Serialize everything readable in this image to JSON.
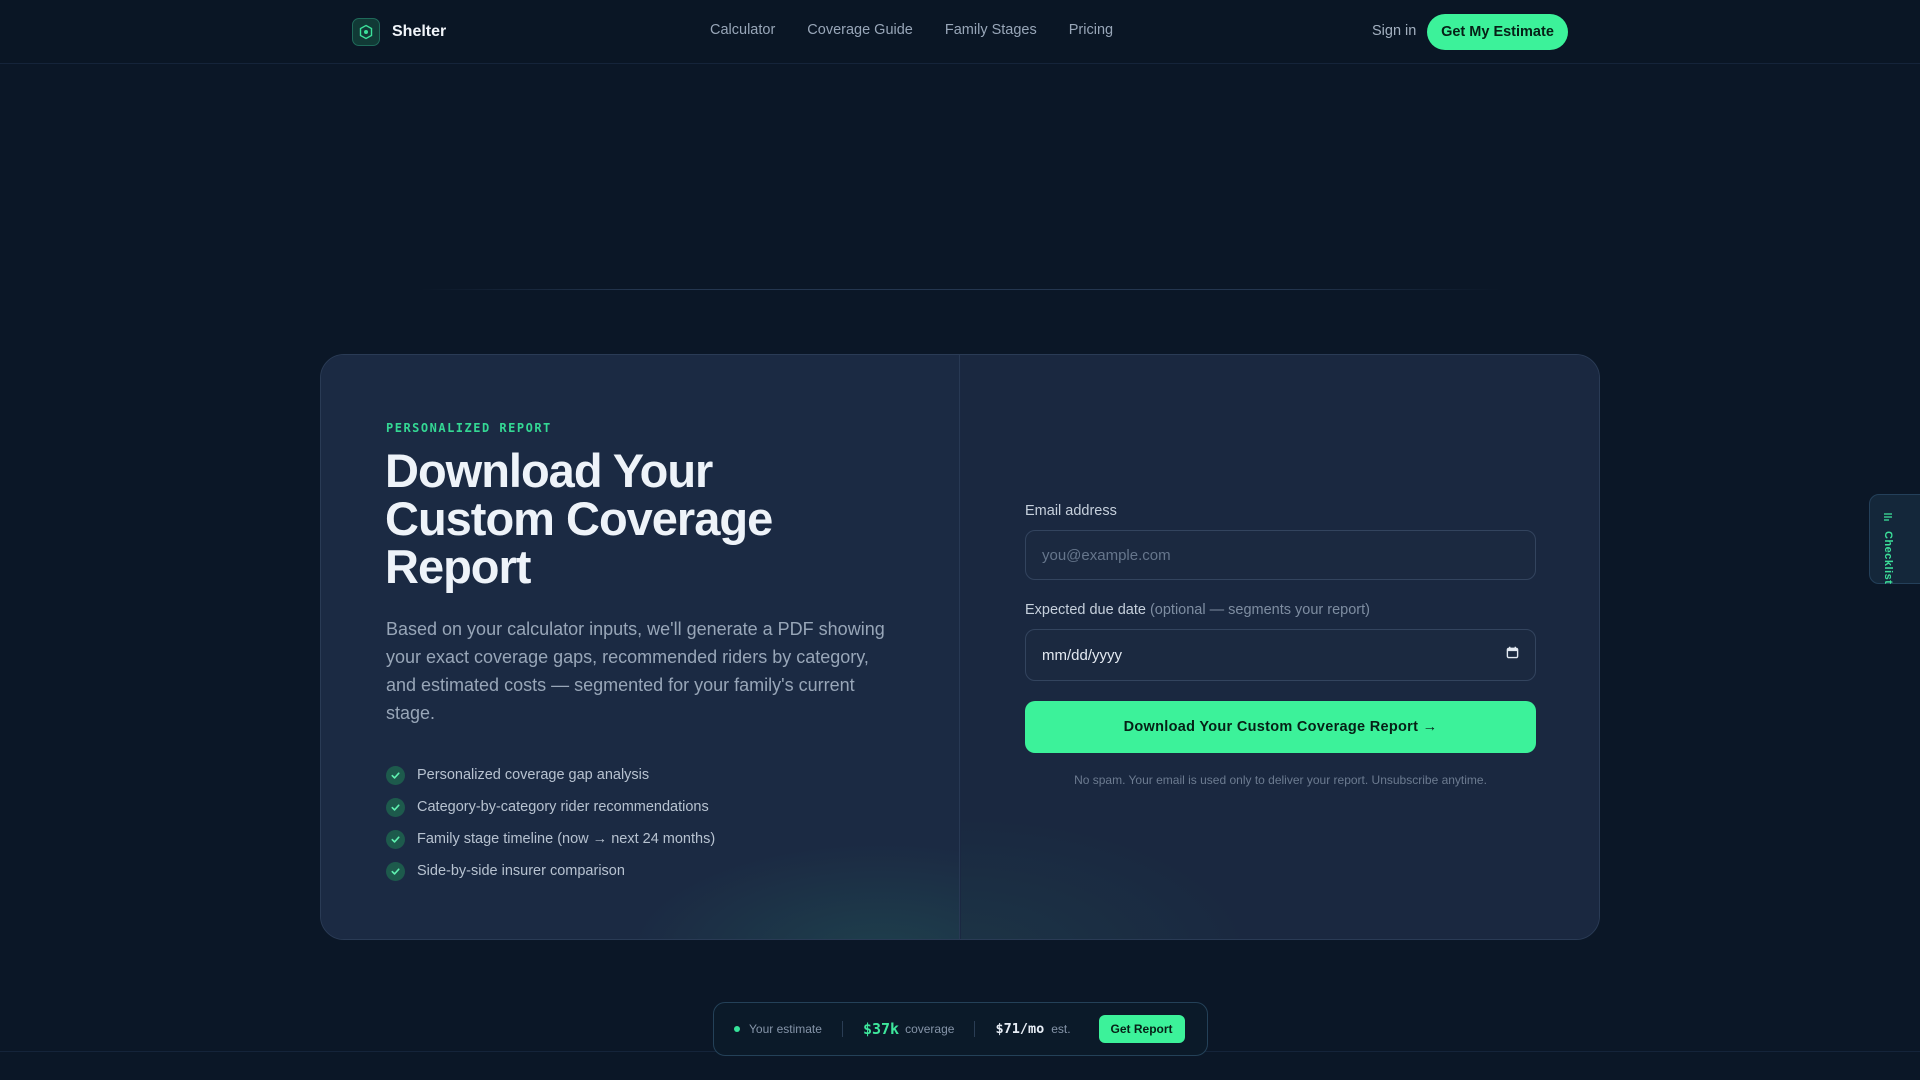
{
  "nav": {
    "brand": "Shelter",
    "links": [
      "Calculator",
      "Coverage Guide",
      "Family Stages",
      "Pricing"
    ],
    "signin": "Sign in",
    "cta": "Get My Estimate"
  },
  "report": {
    "eyebrow": "PERSONALIZED REPORT",
    "title": "Download Your Custom Coverage Report",
    "description": "Based on your calculator inputs, we'll generate a PDF showing your exact coverage gaps, recommended riders by category, and estimated costs — segmented for your family's current stage.",
    "features": [
      "Personalized coverage gap analysis",
      "Category-by-category rider recommendations",
      "Family stage timeline (now → next 24 months)",
      "Side-by-side insurer comparison"
    ]
  },
  "form": {
    "email_label": "Email address",
    "email_placeholder": "you@example.com",
    "date_label": "Expected due date",
    "date_optional": "(optional — segments your report)",
    "date_placeholder": "mm/dd/yyyy",
    "submit": "Download Your Custom Coverage Report →",
    "note": "No spam. Your email is used only to deliver your report. Unsubscribe anytime."
  },
  "side_tab": {
    "label": "Checklist"
  },
  "estimate_bar": {
    "label": "Your estimate",
    "coverage_value": "$37k",
    "coverage_label": "coverage",
    "monthly_value": "$71/mo",
    "monthly_label": "est.",
    "button": "Get Report"
  },
  "colors": {
    "accent": "#3cf29a",
    "background": "#0b1727",
    "card": "#1a2841"
  }
}
